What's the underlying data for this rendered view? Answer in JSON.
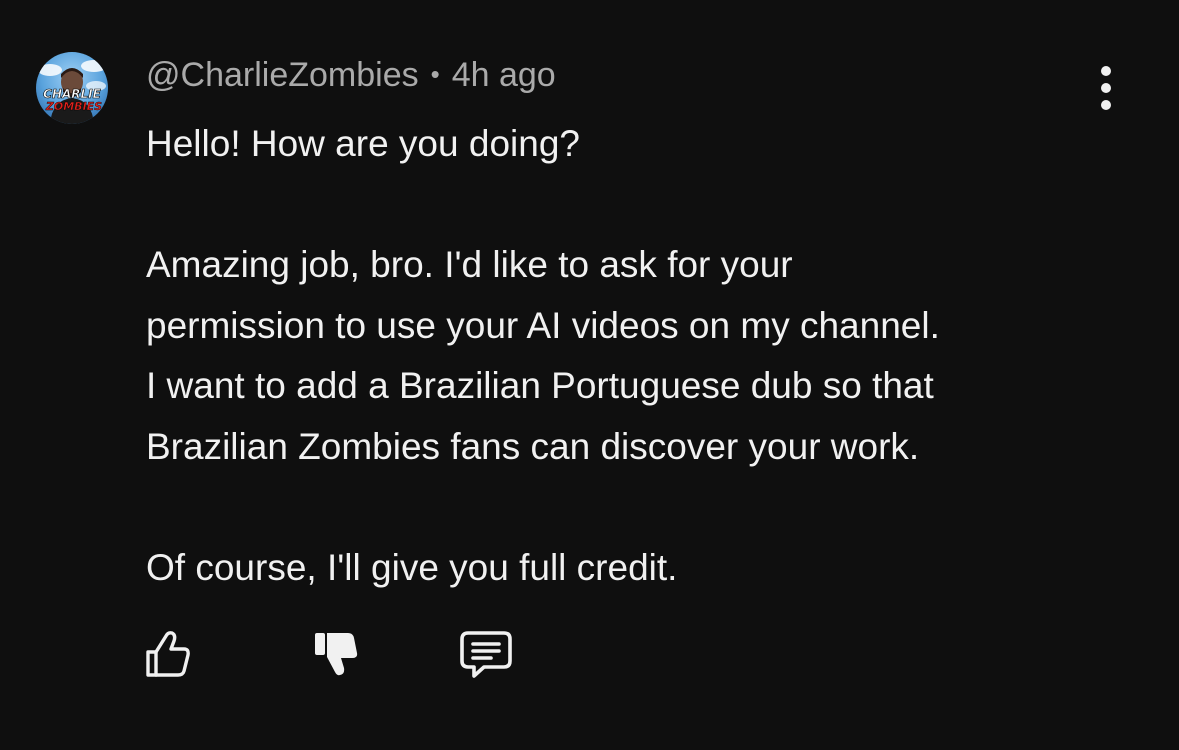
{
  "comment": {
    "author": "@CharlieZombies",
    "separator": "•",
    "time": "4h ago",
    "avatar_text": [
      "CHARLIE",
      "ZOMBIES"
    ],
    "paragraphs": [
      "Hello! How are you doing?",
      "Amazing job, bro. I'd like to ask for your\npermission to use your AI videos on my channel.\nI want to add a Brazilian Portuguese dub so that\nBrazilian Zombies fans can discover your work.",
      "Of course, I'll give you full credit."
    ]
  },
  "icons": {
    "more": "more-vertical-icon",
    "like": "thumbs-up-icon",
    "dislike": "thumbs-down-icon",
    "reply": "reply-comment-icon"
  },
  "colors": {
    "background": "#0f0f0f",
    "text": "#f1f1f1",
    "meta": "#aaaaaa"
  }
}
